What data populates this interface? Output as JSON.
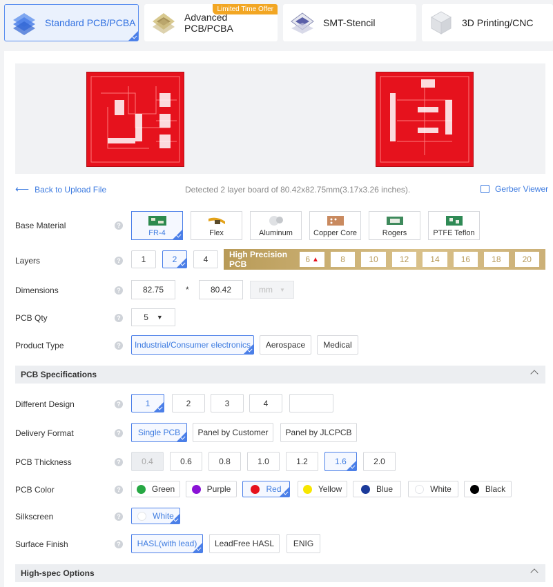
{
  "tabs": [
    {
      "label": "Standard PCB/PCBA",
      "icon": "pcb-stack-icon"
    },
    {
      "label": "Advanced PCB/PCBA",
      "icon": "advanced-chip-icon",
      "badge": "Limited Time Offer"
    },
    {
      "label": "SMT-Stencil",
      "icon": "stencil-icon"
    },
    {
      "label": "3D Printing/CNC",
      "icon": "3d-cube-icon"
    }
  ],
  "preview": {
    "back_label": "Back to Upload File",
    "detected_text": "Detected 2 layer board of 80.42x82.75mm(3.17x3.26 inches).",
    "gerber_label": "Gerber Viewer"
  },
  "base_material": {
    "label": "Base Material",
    "options": [
      "FR-4",
      "Flex",
      "Aluminum",
      "Copper Core",
      "Rogers",
      "PTFE Teflon"
    ],
    "selected": "FR-4"
  },
  "layers": {
    "label": "Layers",
    "options": [
      "1",
      "2",
      "4"
    ],
    "selected": "2",
    "high_precision_label": "High Precision PCB",
    "high_precision_options": [
      "6",
      "8",
      "10",
      "12",
      "14",
      "16",
      "18",
      "20"
    ]
  },
  "dimensions": {
    "label": "Dimensions",
    "width": "82.75",
    "separator": "*",
    "height": "80.42",
    "unit": "mm"
  },
  "qty": {
    "label": "PCB Qty",
    "value": "5"
  },
  "product_type": {
    "label": "Product Type",
    "options": [
      "Industrial/Consumer electronics",
      "Aerospace",
      "Medical"
    ],
    "selected": "Industrial/Consumer electronics"
  },
  "section_specs": "PCB Specifications",
  "different_design": {
    "label": "Different Design",
    "options": [
      "1",
      "2",
      "3",
      "4",
      ""
    ],
    "selected": "1"
  },
  "delivery_format": {
    "label": "Delivery Format",
    "options": [
      "Single PCB",
      "Panel by Customer",
      "Panel by JLCPCB"
    ],
    "selected": "Single PCB"
  },
  "thickness": {
    "label": "PCB Thickness",
    "options": [
      "0.4",
      "0.6",
      "0.8",
      "1.0",
      "1.2",
      "1.6",
      "2.0"
    ],
    "selected": "1.6",
    "disabled": "0.4"
  },
  "color": {
    "label": "PCB Color",
    "options": [
      {
        "name": "Green",
        "hex": "#27a844"
      },
      {
        "name": "Purple",
        "hex": "#8a12d6"
      },
      {
        "name": "Red",
        "hex": "#e6121d"
      },
      {
        "name": "Yellow",
        "hex": "#f7e600"
      },
      {
        "name": "Blue",
        "hex": "#1b3a9a"
      },
      {
        "name": "White",
        "hex": "#ffffff"
      },
      {
        "name": "Black",
        "hex": "#000000"
      }
    ],
    "selected": "Red"
  },
  "silkscreen": {
    "label": "Silkscreen",
    "value": "White"
  },
  "surface_finish": {
    "label": "Surface Finish",
    "options": [
      "HASL(with lead)",
      "LeadFree HASL",
      "ENIG"
    ],
    "selected": "HASL(with lead)"
  },
  "section_highspec": "High-spec Options",
  "help_glyph": "?",
  "accent": "#4b7fe8"
}
